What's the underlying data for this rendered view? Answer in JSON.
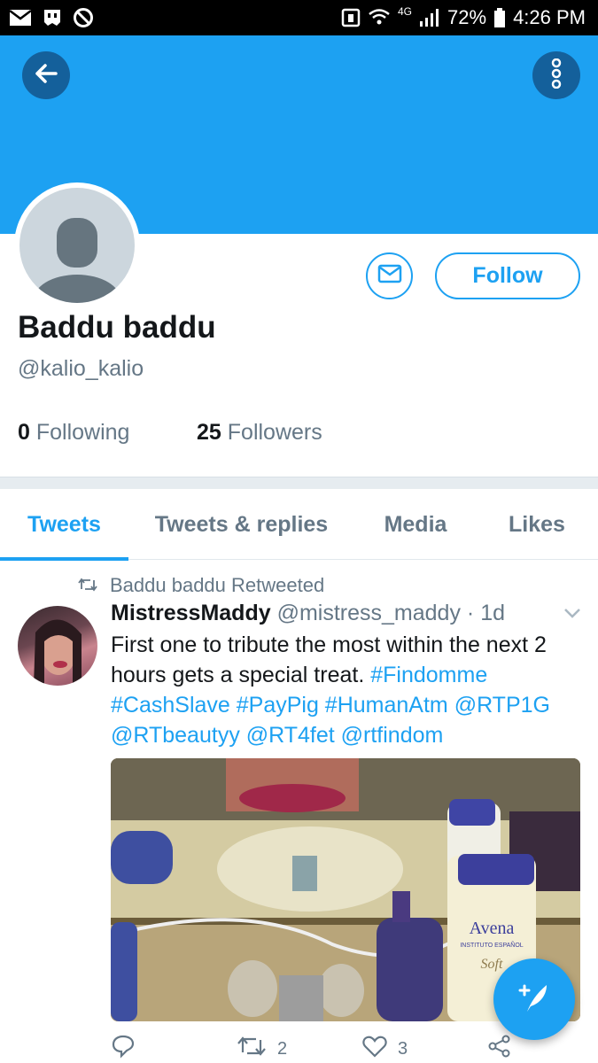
{
  "status_bar": {
    "left_icons": [
      "mail-icon",
      "ghost-icon",
      "blocked-icon"
    ],
    "right_icons": [
      "nfc-icon",
      "wifi-icon",
      "signal-icon",
      "battery-icon"
    ],
    "network": "4G",
    "battery": "72%",
    "time": "4:26 PM"
  },
  "header": {
    "back_icon": "arrow-left-icon",
    "more_icon": "vertical-dots-icon",
    "banner_color": "#1da1f2"
  },
  "profile": {
    "name": "Baddu baddu",
    "handle": "@kalio_kalio",
    "follow_label": "Follow",
    "message_icon": "envelope-icon",
    "following_count": "0",
    "following_label": "Following",
    "followers_count": "25",
    "followers_label": "Followers"
  },
  "tabs": [
    {
      "label": "Tweets",
      "active": true
    },
    {
      "label": "Tweets & replies",
      "active": false
    },
    {
      "label": "Media",
      "active": false
    },
    {
      "label": "Likes",
      "active": false
    }
  ],
  "tweet": {
    "retweet_note": "Baddu baddu Retweeted",
    "author": "MistressMaddy",
    "handle": "@mistress_maddy",
    "separator": "·",
    "time": "1d",
    "text_plain": "First one to tribute the most within the next 2 hours gets a special treat.",
    "text_links": "#Findomme #CashSlave #PayPig #HumanAtm @RTP1G @RTbeautyy @RT4fet @rtfindom",
    "media_label": "Avena",
    "media_sublabel": "INSTITUTO ESPAÑOL",
    "media_script": "Soft",
    "reply_count": "",
    "retweet_count": "2",
    "like_count": "3"
  },
  "fab": {
    "icon": "compose-feather-icon"
  },
  "colors": {
    "accent": "#1da1f2",
    "text": "#14171a",
    "muted": "#657786"
  }
}
